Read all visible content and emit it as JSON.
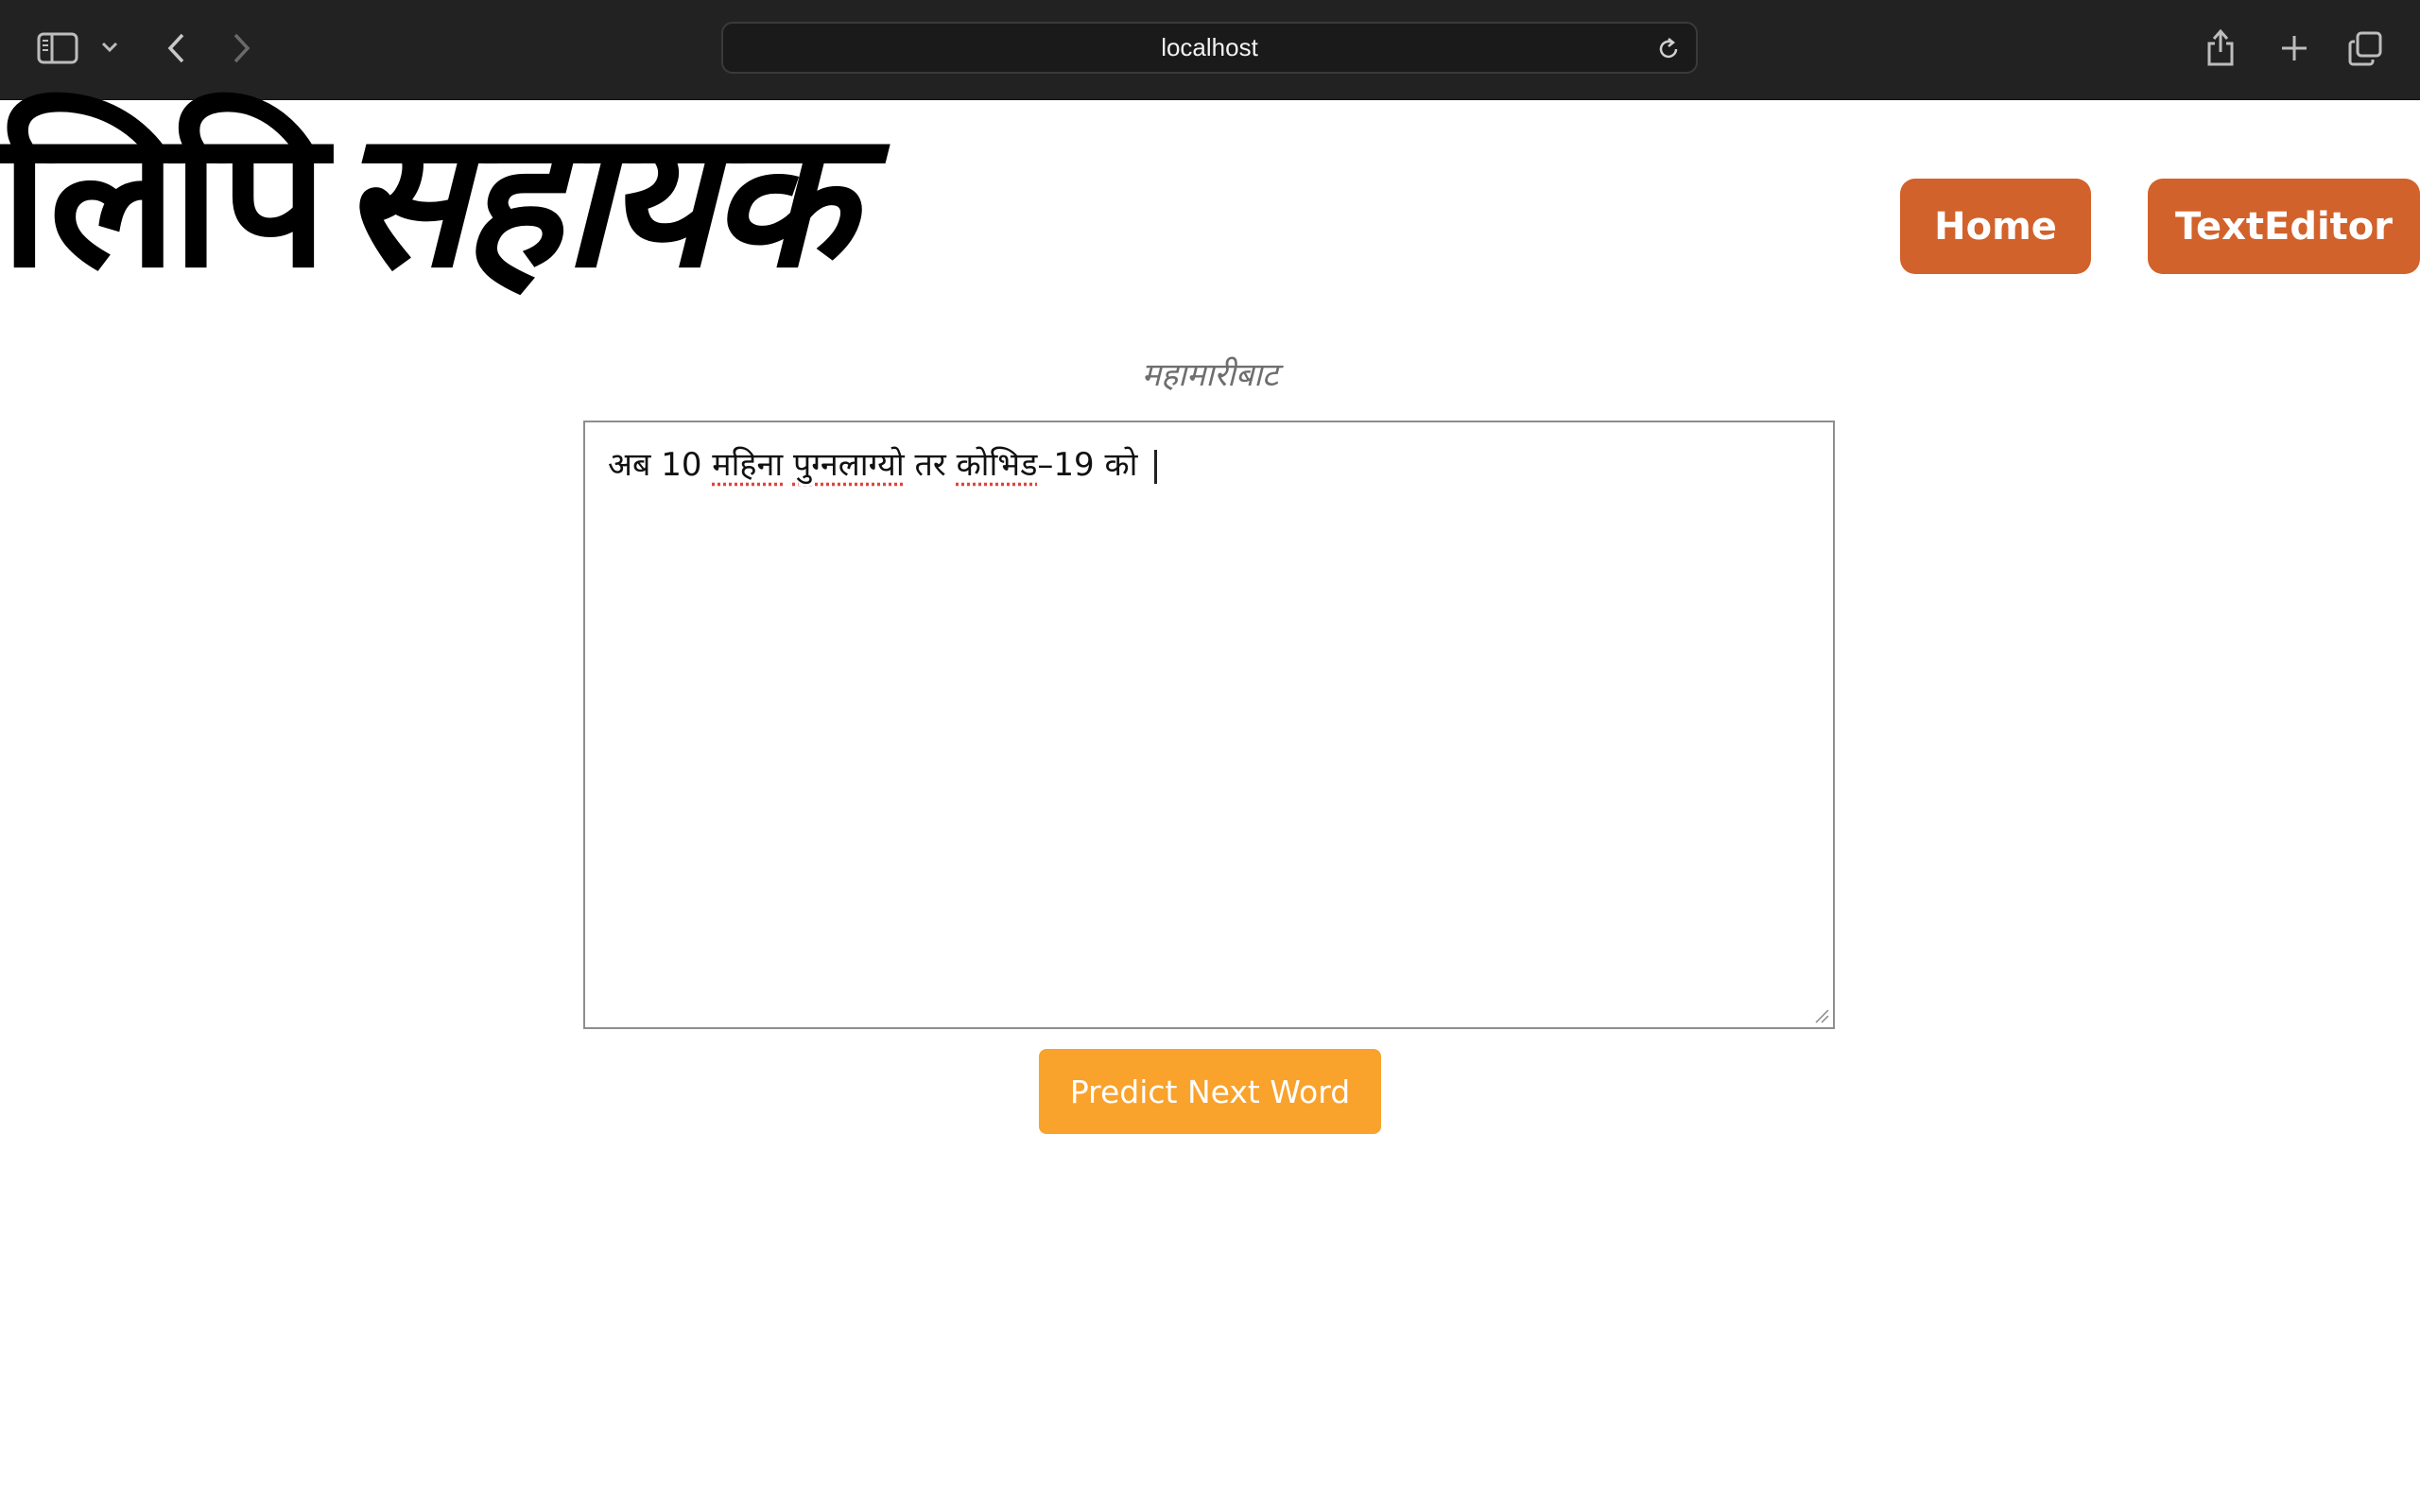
{
  "browser": {
    "url": "localhost",
    "icons": {
      "sidebar": "sidebar-icon",
      "chevron": "chevron-down-icon",
      "back": "chevron-left-icon",
      "forward": "chevron-right-icon",
      "reload": "reload-icon",
      "share": "share-icon",
      "new_tab": "plus-icon",
      "tabs": "tabs-overview-icon"
    }
  },
  "header": {
    "logo_part1": "लिपि",
    "logo_part2": "सहायक",
    "nav": {
      "home_label": "Home",
      "texteditor_label": "TextEditor"
    }
  },
  "main": {
    "prediction": "महामारीबाट",
    "editor": {
      "segments": [
        "अब 10 ",
        "महिना",
        " ",
        "पुग्नलाग्यो",
        " तर ",
        "कोभिड",
        "–19 को"
      ]
    },
    "predict_button_label": "Predict Next Word"
  },
  "colors": {
    "nav_button": "#d2622b",
    "predict_button": "#f9a22c",
    "toolbar": "#222222"
  }
}
